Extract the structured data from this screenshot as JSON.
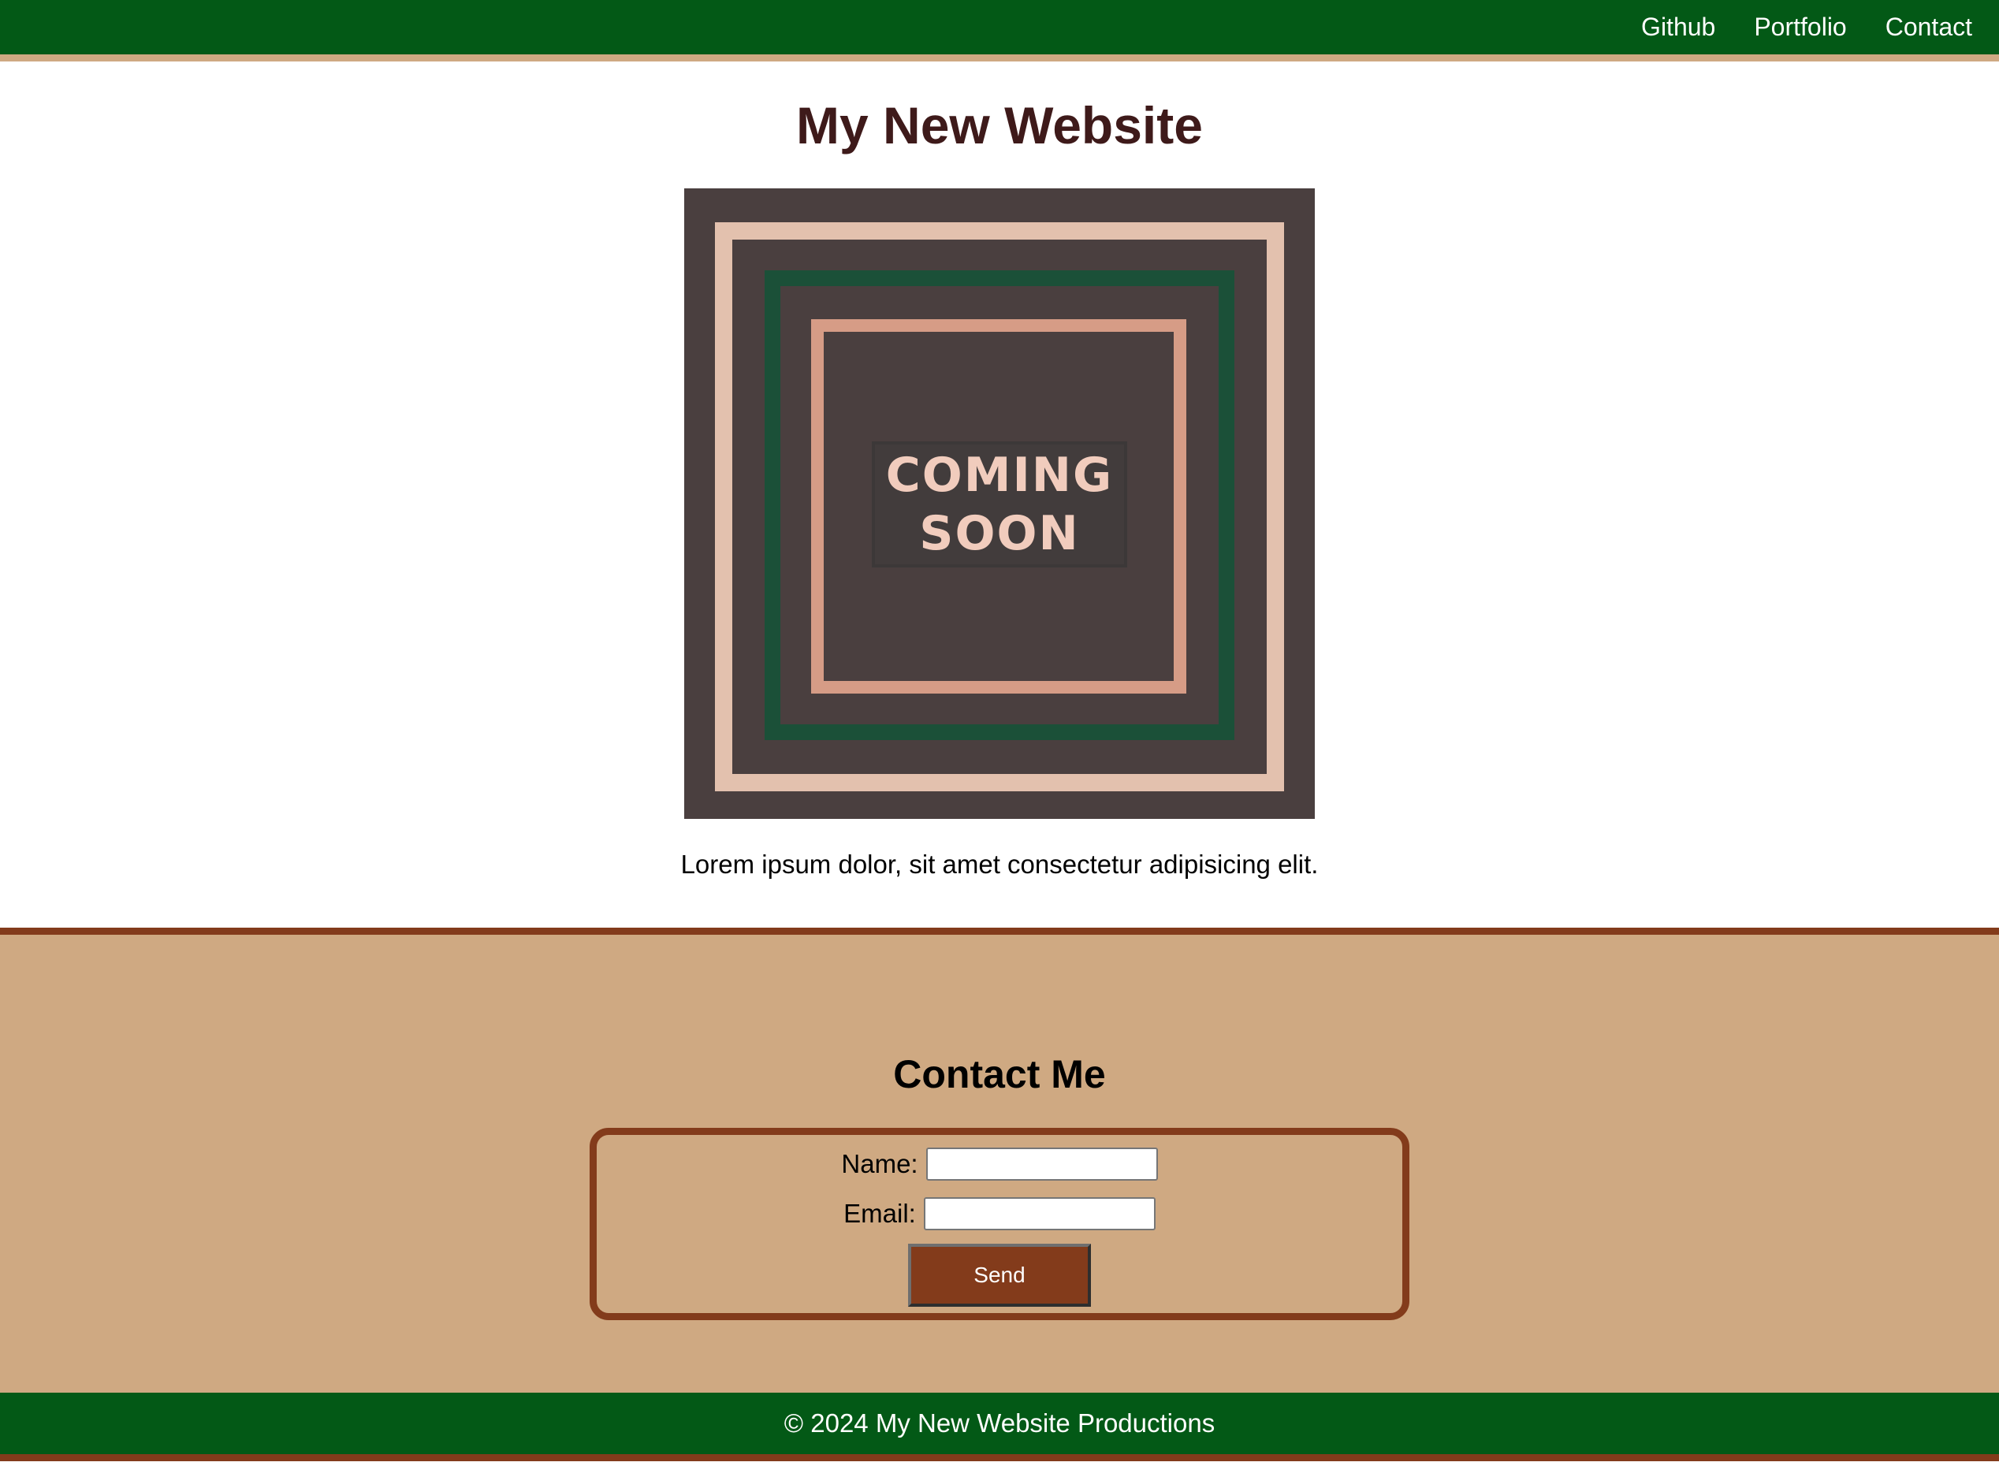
{
  "nav": {
    "links": [
      {
        "label": "Github"
      },
      {
        "label": "Portfolio"
      },
      {
        "label": "Contact"
      }
    ]
  },
  "main": {
    "title": "My New Website",
    "hero_image": {
      "line1": "COMING",
      "line2": "SOON"
    },
    "intro": "Lorem ipsum dolor, sit amet consectetur adipisicing elit."
  },
  "contact": {
    "title": "Contact Me",
    "name_label": "Name:",
    "name_value": "",
    "email_label": "Email:",
    "email_value": "",
    "send_label": "Send"
  },
  "footer": {
    "text": "© 2024 My New Website Productions"
  },
  "colors": {
    "primary_green": "#035916",
    "tan": "#cfa982",
    "rust": "#833b1b",
    "title_maroon": "#3e1a1a",
    "image_background": "#4a3f3f"
  }
}
